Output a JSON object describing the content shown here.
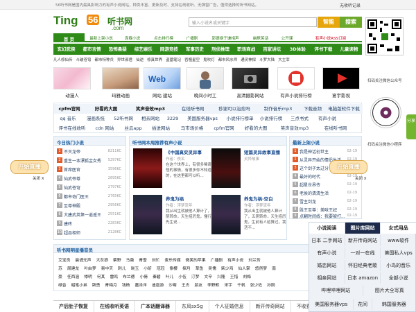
{
  "topbar": {
    "note": "56听书网是国内最具影响力的有声小说网站，种类丰富、更新及时、支持在线收听、无弹窗广告，值得选择的听书网站。",
    "history": "无收听记录"
  },
  "logo": {
    "ting": "Ting",
    "num": "56",
    "cn": "听书网",
    "com": ".com"
  },
  "search": {
    "placeholder": "输入小说名或关键字",
    "smart": "智能",
    "search": "搜索"
  },
  "nav1": [
    "首 页",
    "最新上架小说",
    "连载小说",
    "点击排行榜",
    "广播剧",
    "郭德纲于谦相声",
    "幽默笑话",
    "公开课",
    "有声小说RSS订阅"
  ],
  "nav2": [
    "玄幻武侠",
    "都市言情",
    "恐怖悬疑",
    "综艺娱乐",
    "网游竞技",
    "军事历史",
    "刑侦推理",
    "职场商战",
    "百家讲坛",
    "3D体验",
    "评书下载",
    "儿童读物"
  ],
  "tags": [
    "凡人修仙传",
    "斗破苍穹",
    "都市特种兵",
    "异世邪君",
    "仙逆",
    "修真世界",
    "盗墓笔记",
    "吞噬星空",
    "鬼吹灯",
    "都市风水师",
    "通灵神探",
    "斗罗大陆",
    "大主宰"
  ],
  "thumbs": [
    "动漫人",
    "玛雅动画",
    "网站 建站",
    "晚间小时工",
    "高清摄影网站",
    "有声小说排行榜",
    "宴宇影视"
  ],
  "qr": {
    "label1": "扫码关注微信公众号",
    "label2": "扫码关注微信小程序",
    "side": "分享"
  },
  "links": {
    "row1": [
      "cpfm官网",
      "好看的大图",
      "笑声音效mp3",
      "在线听书网",
      "秒谢可以治愈吗",
      "制作音乐mp3",
      "下载音频",
      "电脑版软件下载"
    ],
    "row2": [
      "qq 音乐",
      "漫画系统",
      "52听书网",
      "相亲网站",
      "3229",
      "美国服务器vps",
      "小说排行榜单",
      "小说排行榜",
      "三点书式",
      "有声小说"
    ],
    "row3": [
      "评书在线收听",
      "cdn 网站",
      "丝瓜app",
      "插进网站",
      "马市场价格",
      "cpfm官网",
      "好看的大图",
      "笑声音效mp3",
      "在线听书网"
    ]
  },
  "float": {
    "left": "开始直播",
    "right": "开始直播",
    "close": "关闭 X"
  },
  "hot": {
    "title": "今日热门小说",
    "items": [
      {
        "t": "不灭龙帝",
        "c": "8211KC"
      },
      {
        "t": "重生一本漂狐金女秀",
        "c": "5297KC"
      },
      {
        "t": "首席医官",
        "c": "3596KC"
      },
      {
        "t": "仙武帝尊",
        "c": "2895KC"
      },
      {
        "t": "仙武苍穹",
        "c": "2797KC"
      },
      {
        "t": "都市奇门医王",
        "c": "2765KC"
      },
      {
        "t": "至尊神殿",
        "c": "2956KC"
      },
      {
        "t": "大唐武英第一逍遥王",
        "c": "2551KC"
      },
      {
        "t": "唐砖",
        "c": "2283KC"
      },
      {
        "t": "超品相师",
        "c": "2128KC"
      }
    ]
  },
  "recommend": {
    "title": "听书网本周推荐有声小说",
    "books": [
      {
        "title": "《中国真实灵异事",
        "author": "作者：佚名",
        "desc": "在这个世界上，有很多稀奇古怪的事情，有很多你不知道的，在这里都可以听..."
      },
      {
        "title": "短篇灵异故事直播",
        "author": "灵异故事",
        "desc": ""
      },
      {
        "title": "养鬼为祸",
        "author": "作者：浮梦流年",
        "desc": "我从出生就被他人算计了，五阴转命，天生招厉鬼，懂行的先生说..."
      },
      {
        "title": "养鬼为祸-空白",
        "author": "作者：浮梦流年",
        "desc": "我从出生就被他人算计了，五阴转命，天生招厉鬼，生前有人给算过，我活不..."
      }
    ]
  },
  "latest": {
    "title": "最新上架小说",
    "items": [
      {
        "t": "我是神话创世主",
        "c": "02-19"
      },
      {
        "t": "从灵异开始的情侣生活",
        "c": "02-19"
      },
      {
        "t": "这个剑子太过分了",
        "c": "02-19"
      },
      {
        "t": "最好的时代",
        "c": "02-19"
      },
      {
        "t": "超星世界传",
        "c": "02-19"
      },
      {
        "t": "老侯的清清生活",
        "c": "02-19"
      },
      {
        "t": "雪主剑龙",
        "c": "02-19"
      },
      {
        "t": "胜王至尊：美味王妃",
        "c": "02-19"
      },
      {
        "t": "点翻时间线：我要被打...",
        "c": "02-19"
      }
    ]
  },
  "anchors": {
    "title": "听书网明星播音员",
    "rows": [
      [
        "艾宝良",
        "晨诵无声",
        "大灰狼",
        "蔡野",
        "马薇",
        "青雪",
        "刘忙",
        "麦乐传媒",
        "微笑的苹果",
        "广播剧",
        "有声小说",
        "刘兰芳"
      ],
      [
        "苏",
        "周建龙",
        "叶由梦",
        "易中天",
        "刺儿",
        "晓玉",
        "小昕",
        "冠冠",
        "紫樱",
        "探月",
        "草鱼",
        "吴儒",
        "柴少鸿",
        "仙人掌",
        "悠然梦",
        "南"
      ],
      [
        "豪",
        "任西涵",
        "悸明",
        "何其",
        "雷鸣",
        "布兰德",
        "小倩",
        "秦碧",
        "叶儿",
        "小伍",
        "汀梦",
        "文辛",
        "兴隆",
        "王惜",
        "刘梅"
      ],
      [
        "绿音",
        "蜡笔小弟",
        "斯勇",
        "青梅月",
        "钱杨",
        "嘉泽洋",
        "迪迦游",
        "沙霉",
        "王杰",
        "朋友",
        "李野默",
        "宋宇",
        "千帆",
        "张少佐",
        "孙刚"
      ]
    ]
  },
  "bottombar": [
    "产后肚子恢复",
    "在线收听英语",
    "广本话翻译器",
    "东风sx5g",
    "个人征婚信息",
    "新开传奇网站",
    "不收费"
  ],
  "popup": {
    "rows": [
      [
        "小说阅读",
        "图片库网站",
        "女式用品"
      ],
      [
        "日本 二手网站",
        "新开传奇网站",
        "www软件"
      ],
      [
        "有声小说",
        "一对一在线",
        "美国私人vps"
      ],
      [
        "婚恋网站",
        "怀旧经典老歌",
        "小鸟的音乐"
      ],
      [
        "相亲网站",
        "日本 amazon",
        "全部小说"
      ],
      [
        "哔哩哔哩网站",
        "图片大全写真"
      ],
      [
        "美国服务器vps",
        "花间",
        "韩国服务器"
      ]
    ]
  }
}
